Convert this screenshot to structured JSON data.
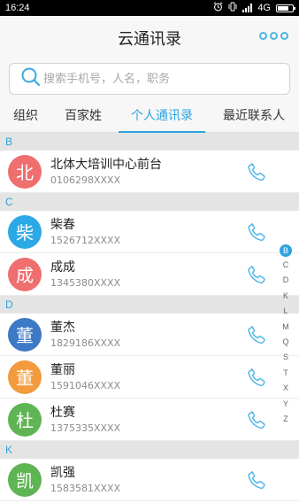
{
  "status": {
    "time": "16:24",
    "network": "4G"
  },
  "header": {
    "title": "云通讯录",
    "more_icon": "more-icon"
  },
  "search": {
    "placeholder": "搜索手机号，人名，职务",
    "value": ""
  },
  "tabs": [
    {
      "label": "组织"
    },
    {
      "label": "百家姓"
    },
    {
      "label": "个人通讯录"
    },
    {
      "label": "最近联系人"
    }
  ],
  "active_tab": "个人通讯录",
  "sections": [
    {
      "letter": "B",
      "contacts": [
        {
          "avatar": "北",
          "color": "#ef6e6e",
          "name": "北体大培训中心前台",
          "phone": "0106298XXXX"
        }
      ]
    },
    {
      "letter": "C",
      "contacts": [
        {
          "avatar": "柴",
          "color": "#2ba9e6",
          "name": "柴春",
          "phone": "1526712XXXX"
        },
        {
          "avatar": "成",
          "color": "#ef6e6e",
          "name": "成成",
          "phone": "1345380XXXX"
        }
      ]
    },
    {
      "letter": "D",
      "contacts": [
        {
          "avatar": "董",
          "color": "#3e79c5",
          "name": "董杰",
          "phone": "1829186XXXX"
        },
        {
          "avatar": "董",
          "color": "#f29a3d",
          "name": "董丽",
          "phone": "1591046XXXX"
        },
        {
          "avatar": "杜",
          "color": "#5fb454",
          "name": "杜赛",
          "phone": "1375335XXXX"
        }
      ]
    },
    {
      "letter": "K",
      "contacts": [
        {
          "avatar": "凯",
          "color": "#5fb454",
          "name": "凯强",
          "phone": "1583581XXXX"
        }
      ]
    }
  ],
  "index_letters": [
    "B",
    "C",
    "D",
    "K",
    "L",
    "M",
    "Q",
    "S",
    "T",
    "X",
    "Y",
    "Z"
  ],
  "index_active": "B",
  "accent_color": "#2ea3dd"
}
